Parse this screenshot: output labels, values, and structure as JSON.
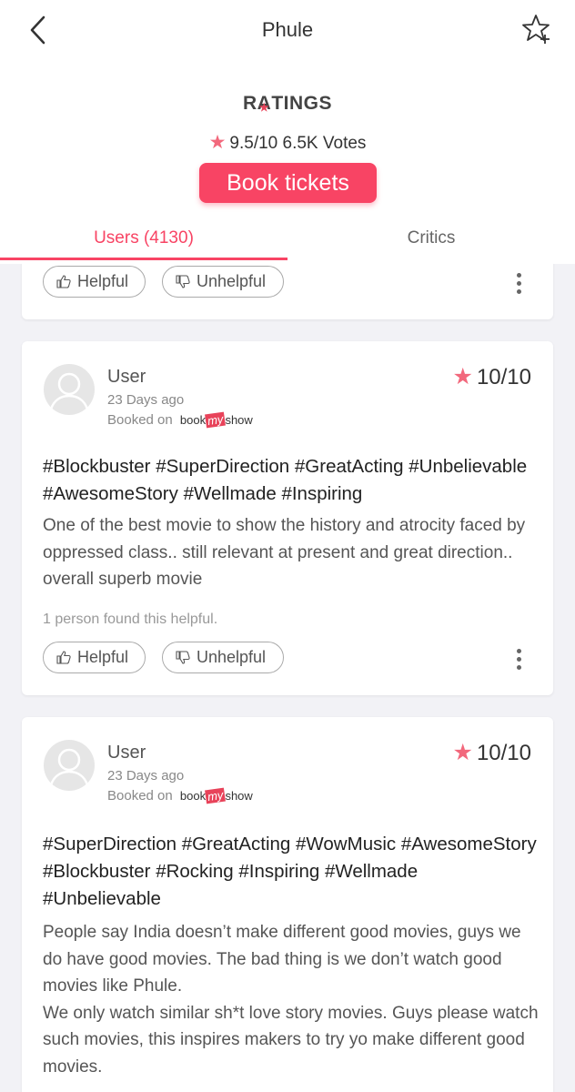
{
  "header": {
    "title": "Phule",
    "ratings_logo_r": "R",
    "ratings_logo_a": "A",
    "ratings_logo_rest": "TINGS",
    "rating_text": "9.5/10 6.5K Votes",
    "book_button": "Book tickets"
  },
  "tabs": [
    {
      "label": "Users (4130)",
      "active": true
    },
    {
      "label": "Critics",
      "active": false
    }
  ],
  "colors": {
    "accent": "#f84464",
    "star": "#f2687c"
  },
  "actions": {
    "helpful": "Helpful",
    "unhelpful": "Unhelpful"
  },
  "reviews": [
    {
      "user": "User",
      "date": "23 Days ago",
      "booked_on": "Booked on",
      "source_logo_book": "book",
      "source_logo_my": "my",
      "source_logo_show": "show",
      "rating": "10/10",
      "tags": "#Blockbuster #SuperDirection #GreatActing #Unbelievable #AwesomeStory #Wellmade #Inspiring",
      "text": "One of the best movie to show the history and atrocity faced by oppressed class.. still relevant at present and great direction.. overall superb movie",
      "helpful_count": "1 person found this helpful."
    },
    {
      "user": "User",
      "date": "23 Days ago",
      "booked_on": "Booked on",
      "source_logo_book": "book",
      "source_logo_my": "my",
      "source_logo_show": "show",
      "rating": "10/10",
      "tags": "#SuperDirection #GreatActing #WowMusic #AwesomeStory #Blockbuster #Rocking #Inspiring #Wellmade #Unbelievable",
      "text": "People say India doesn’t make different good movies, guys we do have good movies. The bad thing is we don’t watch good movies like Phule.\nWe only watch similar sh*t love story movies. Guys please watch such movies, this inspires makers to try yo make different good movies."
    }
  ]
}
